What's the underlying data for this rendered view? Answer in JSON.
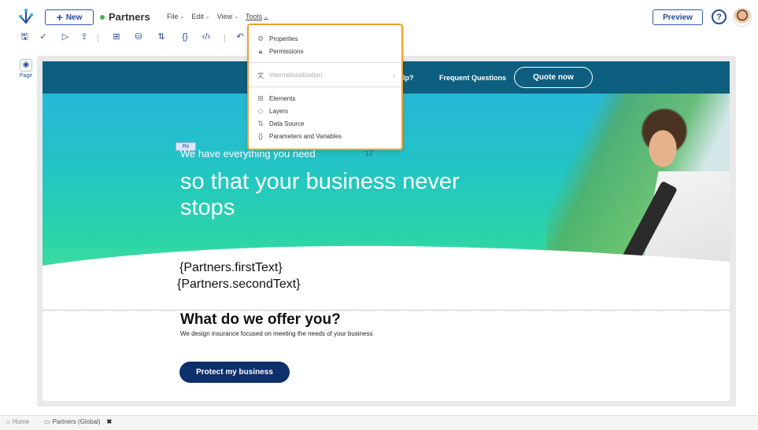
{
  "header": {
    "new_label": "New",
    "app_name": "Partners",
    "menus": [
      "File",
      "Edit",
      "View",
      "Tools"
    ],
    "preview_label": "Preview",
    "help_symbol": "?"
  },
  "left_panel": {
    "page_label": "Page"
  },
  "tools_menu": {
    "items": [
      {
        "label": "Properties",
        "icon": "gear-icon",
        "disabled": false
      },
      {
        "label": "Permissions",
        "icon": "lock-icon",
        "disabled": false
      },
      {
        "label": "Internationalization",
        "icon": "translate-icon",
        "disabled": true
      },
      {
        "label": "Elements",
        "icon": "grid-icon",
        "disabled": false
      },
      {
        "label": "Layers",
        "icon": "layers-icon",
        "disabled": false
      },
      {
        "label": "Data Source",
        "icon": "datasource-icon",
        "disabled": false
      },
      {
        "label": "Parameters and Variables",
        "icon": "braces-icon",
        "disabled": false
      }
    ]
  },
  "canvas": {
    "nav_help": "elp?",
    "nav_faq": "Frequent Questions",
    "nav_quote": "Quote now",
    "rx_badge": "Rx",
    "hero_small": "We have everything you need",
    "hero_big": "so that your business never stops",
    "template_first": "{Partners.firstText}",
    "template_second": "{Partners.secondText}",
    "offer_title": "What do we offer you?",
    "offer_subtitle": "We design insurance focused on meeting the needs of your business",
    "protect_button": "Protect my business"
  },
  "bottom_tabs": {
    "home": "Home",
    "partners": "Partners (Global)"
  },
  "colors": {
    "brand": "#1f4b99",
    "menu_highlight": "#f0a030",
    "cta": "#0d2f6b"
  }
}
